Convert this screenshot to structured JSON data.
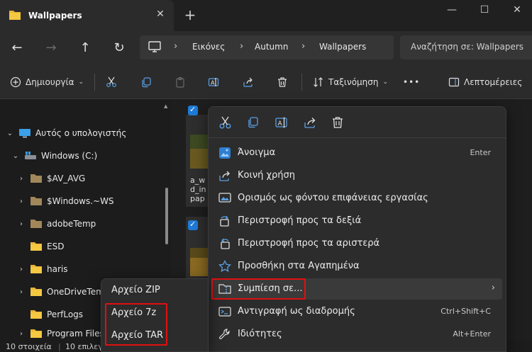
{
  "window": {
    "tab_title": "Wallpapers",
    "tab_close": "✕",
    "new_tab": "+",
    "minimize": "—",
    "maximize": "☐",
    "close": "✕"
  },
  "nav": {
    "back": "←",
    "forward": "→",
    "up": "↑",
    "refresh": "↻"
  },
  "breadcrumb": {
    "sep": "›",
    "items": [
      "Εικόνες",
      "Autumn",
      "Wallpapers"
    ]
  },
  "search": {
    "placeholder": "Αναζήτηση σε: Wallpapers"
  },
  "toolbar": {
    "new_label": "Δημιουργία",
    "sort_label": "Ταξινόμηση",
    "more": "•••",
    "details_label": "Λεπτομέρειες"
  },
  "sidebar": {
    "items": [
      {
        "label": "Αυτός ο υπολογιστής",
        "chev": "⌄"
      },
      {
        "label": "Windows (C:)",
        "chev": "⌄"
      },
      {
        "label": "$AV_AVG",
        "chev": "›"
      },
      {
        "label": "$Windows.~WS",
        "chev": "›"
      },
      {
        "label": "adobeTemp",
        "chev": "›"
      },
      {
        "label": "ESD",
        "chev": ""
      },
      {
        "label": "haris",
        "chev": "›"
      },
      {
        "label": "OneDriveTemp",
        "chev": "›"
      },
      {
        "label": "PerfLogs",
        "chev": ""
      },
      {
        "label": "Program Files",
        "chev": "›"
      }
    ]
  },
  "content": {
    "thumb_text_1": "a_w",
    "thumb_text_2": "d_in",
    "thumb_text_3": "pap"
  },
  "status": {
    "count": "10 στοιχεία",
    "selected": "10 επιλεγ"
  },
  "context_menu": {
    "items": [
      {
        "label": "Άνοιγμα",
        "shortcut": "Enter"
      },
      {
        "label": "Κοινή χρήση",
        "shortcut": ""
      },
      {
        "label": "Ορισμός ως φόντου επιφάνειας εργασίας",
        "shortcut": ""
      },
      {
        "label": "Περιστροφή προς τα δεξιά",
        "shortcut": ""
      },
      {
        "label": "Περιστροφή προς τα αριστερά",
        "shortcut": ""
      },
      {
        "label": "Προσθήκη στα Αγαπημένα",
        "shortcut": ""
      },
      {
        "label": "Συμπίεση σε...",
        "shortcut": "",
        "submenu_arrow": "›"
      },
      {
        "label": "Αντιγραφή ως διαδρομής",
        "shortcut": "Ctrl+Shift+C"
      },
      {
        "label": "Ιδιότητες",
        "shortcut": "Alt+Enter"
      }
    ]
  },
  "submenu": {
    "items": [
      "Αρχείο ZIP",
      "Αρχείο 7z",
      "Αρχείο TAR"
    ]
  },
  "colors": {
    "accent": "#1f7ad6",
    "highlight": "#e01010",
    "folder": "#e8b53a"
  }
}
